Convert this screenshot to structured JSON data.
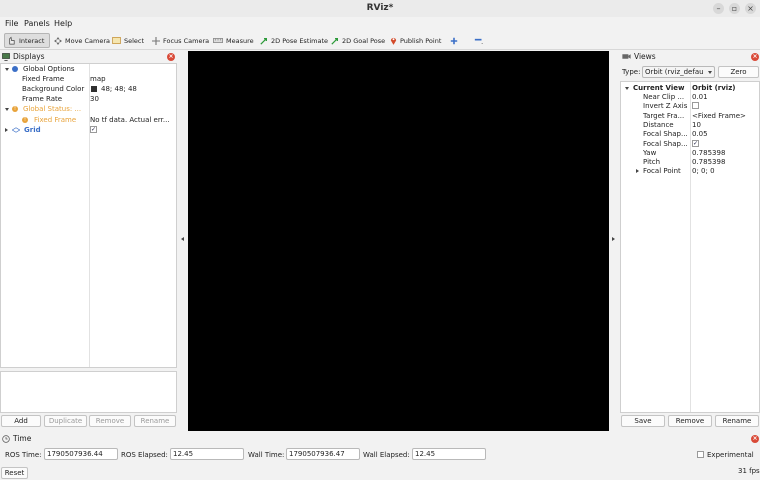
{
  "window": {
    "title": "RViz*"
  },
  "menu": {
    "file": "File",
    "panels": "Panels",
    "help": "Help"
  },
  "toolbar": {
    "interact": "Interact",
    "move_camera": "Move Camera",
    "select": "Select",
    "focus_camera": "Focus Camera",
    "measure": "Measure",
    "pose_estimate": "2D Pose Estimate",
    "goal_pose": "2D Goal Pose",
    "publish_point": "Publish Point"
  },
  "displays": {
    "title": "Displays",
    "global_options": {
      "label": "Global Options",
      "fixed_frame_label": "Fixed Frame",
      "fixed_frame_value": "map",
      "background_label": "Background Color",
      "background_value": "48; 48; 48",
      "background_swatch": "#303030",
      "frame_rate_label": "Frame Rate",
      "frame_rate_value": "30"
    },
    "global_status": {
      "label": "Global Status: ...",
      "fixed_frame_label": "Fixed Frame",
      "fixed_frame_value": "No tf data.  Actual err...",
      "warn_color": "#e8a33a"
    },
    "grid": {
      "label": "Grid",
      "checked": "✓"
    },
    "buttons": {
      "add": "Add",
      "duplicate": "Duplicate",
      "remove": "Remove",
      "rename": "Rename"
    }
  },
  "views": {
    "title": "Views",
    "type_label": "Type:",
    "type_value": "Orbit (rviz_defau",
    "zero": "Zero",
    "current_view_label": "Current View",
    "current_view_value": "Orbit (rviz)",
    "props": [
      {
        "label": "Near Clip ...",
        "value": "0.01"
      },
      {
        "label": "Invert Z Axis",
        "value": ""
      },
      {
        "label": "Target Fra...",
        "value": "<Fixed Frame>"
      },
      {
        "label": "Distance",
        "value": "10"
      },
      {
        "label": "Focal Shap...",
        "value": "0.05"
      },
      {
        "label": "Focal Shap...",
        "value": "✓"
      },
      {
        "label": "Yaw",
        "value": "0.785398"
      },
      {
        "label": "Pitch",
        "value": "0.785398"
      },
      {
        "label": "Focal Point",
        "value": "0; 0; 0"
      }
    ],
    "buttons": {
      "save": "Save",
      "remove": "Remove",
      "rename": "Rename"
    }
  },
  "time": {
    "title": "Time",
    "ros_time_label": "ROS Time:",
    "ros_time_value": "1790507936.44",
    "ros_elapsed_label": "ROS Elapsed:",
    "ros_elapsed_value": "12.45",
    "wall_time_label": "Wall Time:",
    "wall_time_value": "1790507936.47",
    "wall_elapsed_label": "Wall Elapsed:",
    "wall_elapsed_value": "12.45",
    "experimental": "Experimental"
  },
  "status": {
    "reset": "Reset",
    "fps": "31 fps"
  },
  "colors": {
    "accent_blue": "#3b6fc7",
    "close_red": "#d94a38",
    "viewport": "#000000"
  }
}
